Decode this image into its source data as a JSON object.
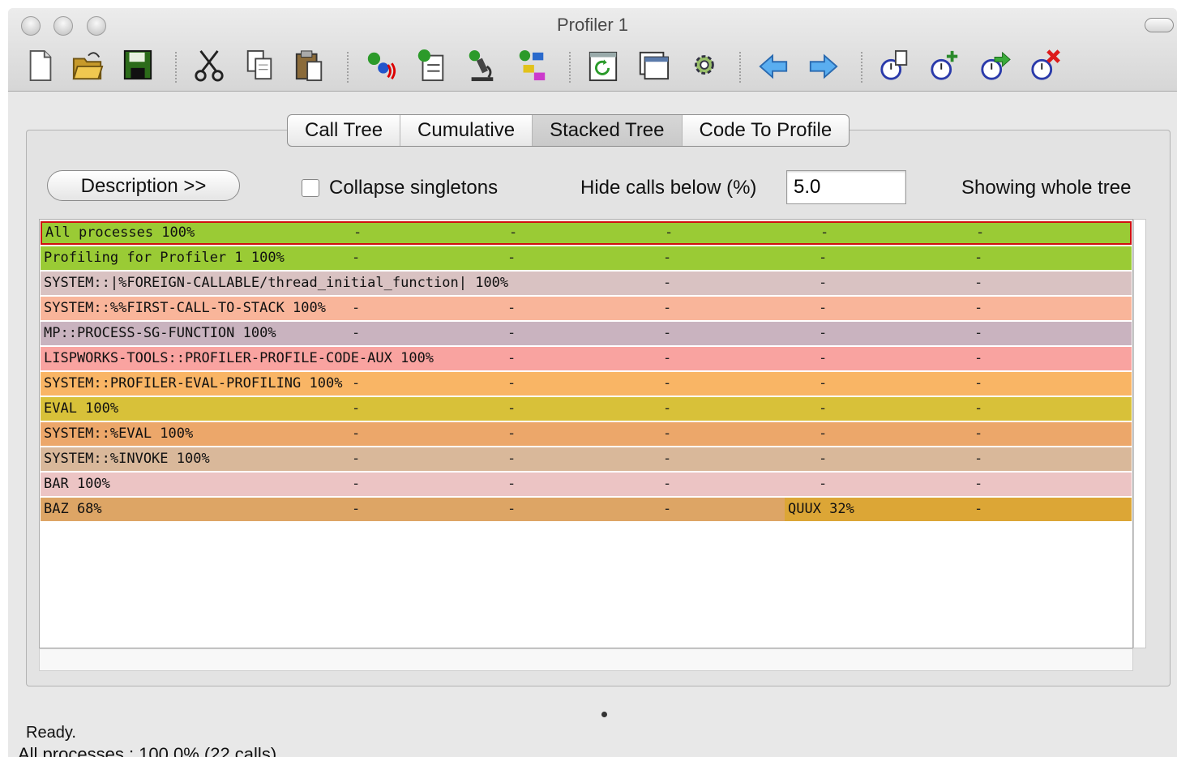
{
  "window": {
    "title": "Profiler 1"
  },
  "toolbar": {
    "groups": [
      [
        "new-file-icon",
        "open-folder-icon",
        "save-icon"
      ],
      [
        "cut-icon",
        "copy-icon",
        "paste-icon"
      ],
      [
        "profile-icon",
        "inspect-icon",
        "microscope-icon",
        "structure-icon"
      ],
      [
        "refresh-icon",
        "window-icon",
        "gear-icon"
      ],
      [
        "back-arrow-icon",
        "forward-arrow-icon"
      ],
      [
        "stopwatch-document-icon",
        "stopwatch-add-icon",
        "stopwatch-go-icon",
        "stopwatch-delete-icon"
      ]
    ]
  },
  "tabs": [
    {
      "label": "Call Tree",
      "active": false
    },
    {
      "label": "Cumulative",
      "active": false
    },
    {
      "label": "Stacked Tree",
      "active": true
    },
    {
      "label": "Code To Profile",
      "active": false
    }
  ],
  "controls": {
    "description_button": "Description >>",
    "collapse_label": "Collapse singletons",
    "collapse_checked": false,
    "hide_label": "Hide calls below (%)",
    "hide_value": "5.0",
    "showing_text": "Showing whole tree"
  },
  "tree": {
    "rows": [
      {
        "text": "All processes 100%",
        "color": "#9acb35",
        "selected": true
      },
      {
        "text": "Profiling for Profiler 1 100%",
        "color": "#9acb35"
      },
      {
        "text": "SYSTEM::|%FOREIGN-CALLABLE/thread_initial_function| 100%",
        "color": "#d9c2c2"
      },
      {
        "text": "SYSTEM::%%FIRST-CALL-TO-STACK 100%",
        "color": "#f9b59a"
      },
      {
        "text": "MP::PROCESS-SG-FUNCTION 100%",
        "color": "#c9b3bf"
      },
      {
        "text": "LISPWORKS-TOOLS::PROFILER-PROFILE-CODE-AUX 100%",
        "color": "#f9a3a0"
      },
      {
        "text": "SYSTEM::PROFILER-EVAL-PROFILING 100%",
        "color": "#f9b565"
      },
      {
        "text": "EVAL 100%",
        "color": "#d8c139"
      },
      {
        "text": "SYSTEM::%EVAL 100%",
        "color": "#eca76a"
      },
      {
        "text": "SYSTEM::%INVOKE 100%",
        "color": "#d9b89a"
      },
      {
        "text": "BAR 100%",
        "color": "#ecc4c4"
      },
      {
        "text": "BAZ 68%",
        "color": "#dda565",
        "second": {
          "text": "QUUX 32%",
          "color": "#dca636"
        }
      }
    ],
    "marker": "-"
  },
  "status": {
    "line1": "Ready.",
    "line2": "All processes :  100.0% (22 calls)"
  }
}
